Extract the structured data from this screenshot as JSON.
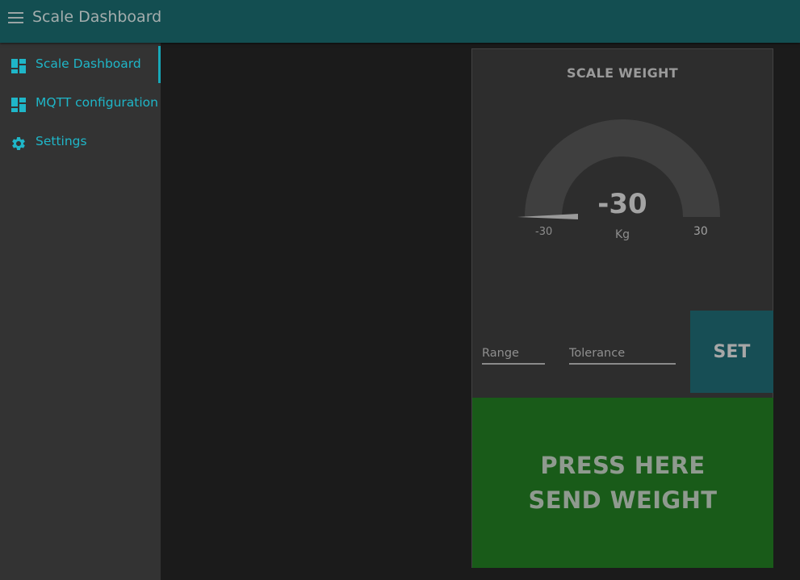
{
  "header": {
    "title": "Scale Dashboard",
    "menu_icon": "hamburger-menu-icon"
  },
  "sidebar": {
    "items": [
      {
        "label": "Scale Dashboard",
        "icon": "dashboard-icon",
        "active": true
      },
      {
        "label": "MQTT configuration",
        "icon": "dashboard-icon",
        "active": false
      },
      {
        "label": "Settings",
        "icon": "gear-icon",
        "active": false
      }
    ]
  },
  "card": {
    "title": "SCALE WEIGHT",
    "gauge": {
      "value": "-30",
      "unit": "Kg",
      "min": "-30",
      "max": "30"
    },
    "range": {
      "placeholder": "Range",
      "value": ""
    },
    "tolerance": {
      "placeholder": "Tolerance",
      "value": ""
    },
    "set_label": "SET",
    "send_button": {
      "line1": "PRESS HERE",
      "line2": "SEND WEIGHT"
    }
  },
  "colors": {
    "header_bg": "#134e51",
    "accent": "#1fb6c8",
    "sidebar_bg": "#333333",
    "card_bg": "#2d2d2d",
    "set_button_bg": "#174e55",
    "send_button_bg": "#195b19"
  }
}
